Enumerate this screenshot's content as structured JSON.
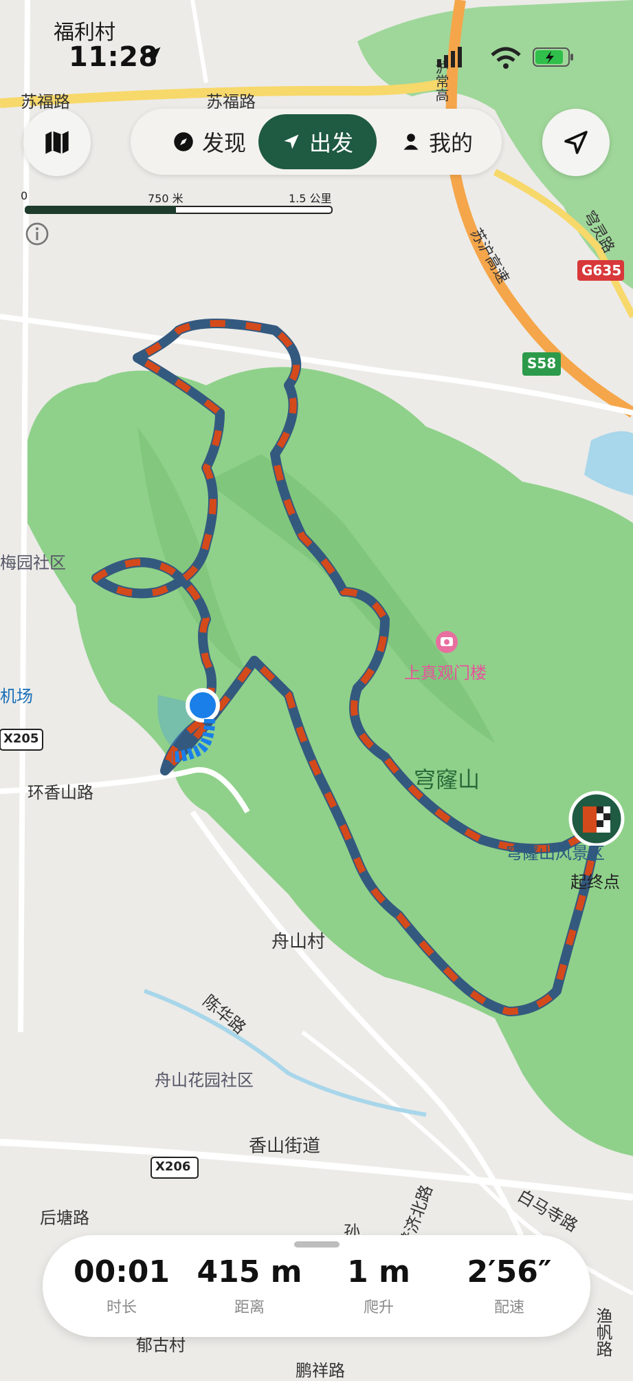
{
  "status": {
    "location": "福利村",
    "time": "11:28"
  },
  "nav": {
    "discover": "发现",
    "depart": "出发",
    "mine": "我的"
  },
  "scale": {
    "zero": "0",
    "mid": "750 米",
    "end": "1.5 公里"
  },
  "map_labels": {
    "road_sufu_1": "苏福路",
    "road_sufu_2": "苏福路",
    "highway_hu": "沪常高",
    "highway_su": "苏沪高速",
    "road_qionglong": "穹灵路",
    "badge_g635": "G635",
    "badge_s58": "S58",
    "meiyuan": "梅园社区",
    "airport": "机场",
    "badge_x205": "X205",
    "huanxiangshan": "环香山路",
    "shangzhenguan": "上真观门楼",
    "qionglongshan": "穹窿山",
    "scenic_area": "穹窿山风景区",
    "start_end": "起终点",
    "zhoushan_village": "舟山村",
    "chenhua_road": "陈华路",
    "zhoushan_garden": "舟山花园社区",
    "xiangshan_street": "香山街道",
    "badge_x206": "X206",
    "puji_north": "普济北路",
    "baima_temple": "白马寺路",
    "houtang_road": "后塘路",
    "sun_road": "孙",
    "yufan_road": "渔帆路",
    "xiangjia": "郁古村",
    "pengxiang_road": "鹏祥路"
  },
  "stats": [
    {
      "value": "00:01",
      "label": "时长"
    },
    {
      "value": "415 m",
      "label": "距离"
    },
    {
      "value": "1 m",
      "label": "爬升"
    },
    {
      "value": "2′56″",
      "label": "配速"
    }
  ],
  "colors": {
    "park": "#8fd18a",
    "route_blue": "#34597f",
    "route_orange": "#d44a1a",
    "accent_green": "#1f5a42",
    "user_dot": "#1a7fe8"
  }
}
